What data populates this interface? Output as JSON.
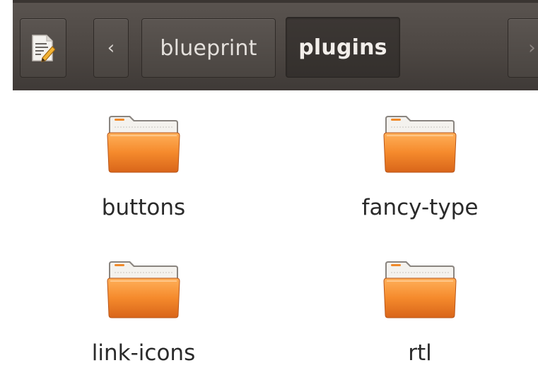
{
  "toolbar": {
    "edit_icon": "text-editor-icon",
    "back_icon": "chevron-left-icon",
    "forward_icon": "chevron-right-icon",
    "back_glyph": "‹",
    "forward_glyph": "›",
    "breadcrumbs": [
      {
        "label": "blueprint",
        "active": false
      },
      {
        "label": "plugins",
        "active": true
      }
    ]
  },
  "files": [
    {
      "name": "buttons",
      "icon": "folder-icon"
    },
    {
      "name": "fancy-type",
      "icon": "folder-icon"
    },
    {
      "name": "link-icons",
      "icon": "folder-icon"
    },
    {
      "name": "rtl",
      "icon": "folder-icon"
    }
  ],
  "colors": {
    "toolbar_bg": "#4d4743",
    "folder_orange": "#f08a2a",
    "folder_tab": "#f2f0ec"
  }
}
